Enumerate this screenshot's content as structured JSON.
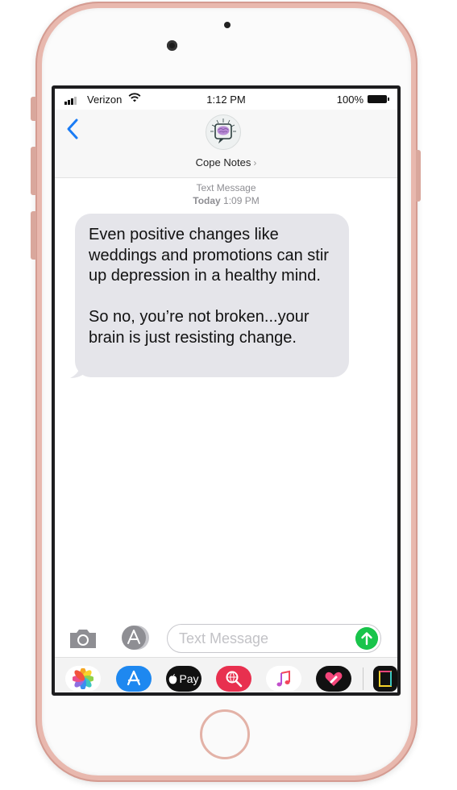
{
  "status_bar": {
    "carrier": "Verizon",
    "time": "1:12 PM",
    "battery": "100%"
  },
  "conversation": {
    "contact_name": "Cope Notes",
    "chevron": "›"
  },
  "thread_meta": {
    "service": "Text Message",
    "date_label": "Today",
    "date_time": "1:09 PM"
  },
  "message": {
    "paragraph_1": "Even positive changes like weddings and promotions can stir up depression in a healthy mind.",
    "paragraph_2": "So no, you’re not broken...your brain is just resisting change."
  },
  "composer": {
    "placeholder": "Text Message"
  },
  "app_tray": {
    "items": [
      "photos-icon",
      "app-store-icon",
      "apple-pay-icon",
      "web-search-icon",
      "music-icon",
      "digital-touch-icon",
      "stickers-icon"
    ],
    "apple_pay_label": "Pay"
  },
  "colors": {
    "bubble": "#e5e5ea",
    "accent": "#1a7cf5",
    "send": "#19c44b",
    "frame": "#e8b8ae"
  }
}
